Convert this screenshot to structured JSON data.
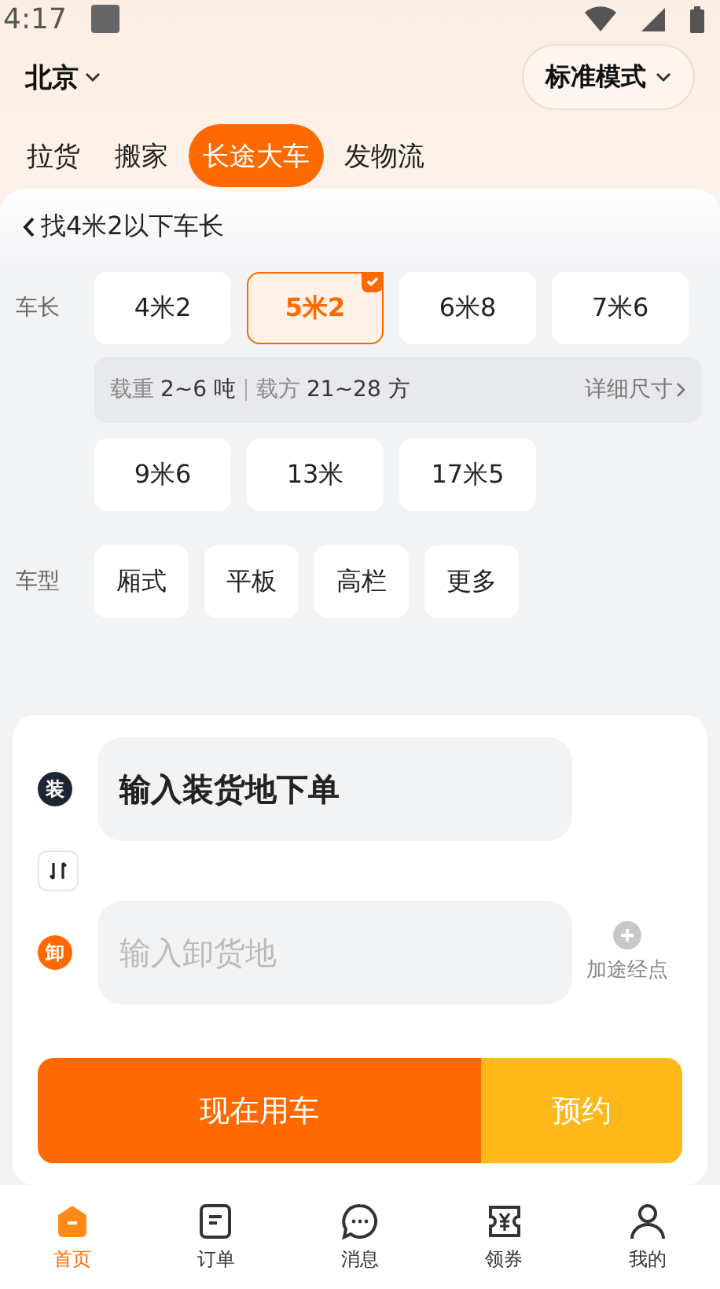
{
  "status_bar": {
    "time": "4:17"
  },
  "header": {
    "city": "北京",
    "mode": "标准模式"
  },
  "tabs": [
    {
      "label": "拉货",
      "selected": false
    },
    {
      "label": "搬家",
      "selected": false
    },
    {
      "label": "长途大车",
      "selected": true
    },
    {
      "label": "发物流",
      "selected": false
    }
  ],
  "back_link": "找4米2以下车长",
  "length_label": "车长",
  "lengths_row1": [
    {
      "label": "4米2",
      "selected": false
    },
    {
      "label": "5米2",
      "selected": true
    },
    {
      "label": "6米8",
      "selected": false
    },
    {
      "label": "7米6",
      "selected": false
    }
  ],
  "spec": {
    "load_label": "载重",
    "load_value": "2~6 吨",
    "volume_label": "载方",
    "volume_value": "21~28 方",
    "detail_link": "详细尺寸"
  },
  "lengths_row2": [
    {
      "label": "9米6",
      "selected": false
    },
    {
      "label": "13米",
      "selected": false
    },
    {
      "label": "17米5",
      "selected": false
    }
  ],
  "type_label": "车型",
  "types": [
    "厢式",
    "平板",
    "高栏",
    "更多"
  ],
  "route": {
    "load_badge": "装",
    "load_field": "输入装货地下单",
    "unload_badge": "卸",
    "unload_placeholder": "输入卸货地",
    "add_stop": "加途经点"
  },
  "actions": {
    "now": "现在用车",
    "reserve": "预约"
  },
  "nav": [
    {
      "label": "首页",
      "selected": true,
      "kind": "home"
    },
    {
      "label": "订单",
      "selected": false,
      "kind": "orders"
    },
    {
      "label": "消息",
      "selected": false,
      "kind": "messages"
    },
    {
      "label": "领券",
      "selected": false,
      "kind": "coupons"
    },
    {
      "label": "我的",
      "selected": false,
      "kind": "profile"
    }
  ]
}
